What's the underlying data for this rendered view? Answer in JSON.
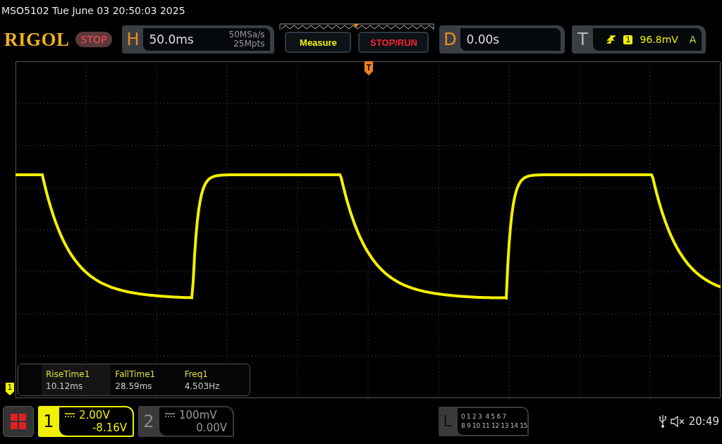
{
  "title": "MSO5102  Tue June 03 20:50:03 2025",
  "logo": "RIGOL",
  "run_state": {
    "label": "STOP"
  },
  "horizontal": {
    "key": "H",
    "timebase": "50.0ms",
    "sample_rate": "50MSa/s",
    "memory_depth": "25Mpts"
  },
  "buttons": [
    {
      "label": "Measure",
      "kind": "measure"
    },
    {
      "label": "STOP/RUN",
      "kind": "stoprun"
    }
  ],
  "delay": {
    "key": "D",
    "value": "0.00s"
  },
  "trigger": {
    "key": "T",
    "source": "1",
    "level": "96.8mV",
    "mode": "A"
  },
  "channel_marker": "1",
  "measurements": [
    {
      "name": "RiseTime1",
      "value": "10.12ms"
    },
    {
      "name": "FallTime1",
      "value": "28.59ms"
    },
    {
      "name": "Freq1",
      "value": "4.503Hz"
    }
  ],
  "channels": [
    {
      "number": "1",
      "selected": true,
      "scale": "2.00V",
      "offset": "-8.16V"
    },
    {
      "number": "2",
      "selected": false,
      "scale": "100mV",
      "offset": "0.00V"
    }
  ],
  "logic": {
    "key": "L",
    "rows": [
      "0 1 2 3  4 5 6 7",
      "8 9 10 11 12 13 14 15"
    ]
  },
  "clock": "20:49"
}
